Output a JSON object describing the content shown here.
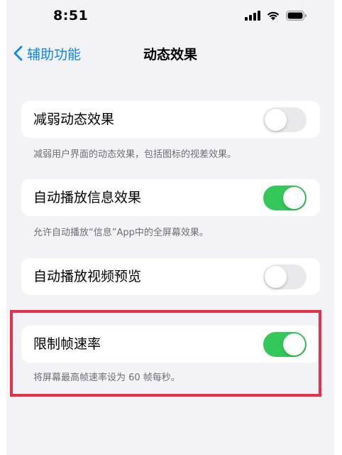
{
  "status_bar": {
    "time": "8:51",
    "icons": [
      "cellular-signal-icon",
      "wifi-icon",
      "battery-icon"
    ]
  },
  "nav": {
    "back_label": "辅助功能",
    "title": "动态效果"
  },
  "settings": [
    {
      "label": "减弱动态效果",
      "enabled": false,
      "footer": "减弱用户界面的动态效果，包括图标的视差效果。"
    },
    {
      "label": "自动播放信息效果",
      "enabled": true,
      "footer": "允许自动播放“信息”App中的全屏幕效果。"
    },
    {
      "label": "自动播放视频预览",
      "enabled": false
    },
    {
      "label": "限制帧速率",
      "enabled": true,
      "footer": "将屏幕最高帧速率设为 60 帧每秒。",
      "highlighted": true
    }
  ],
  "colors": {
    "accent_blue": "#0a84ff",
    "toggle_on": "#34c759",
    "toggle_off": "#e9e9eb",
    "highlight": "#e8304a",
    "background": "#f2f2f7"
  }
}
